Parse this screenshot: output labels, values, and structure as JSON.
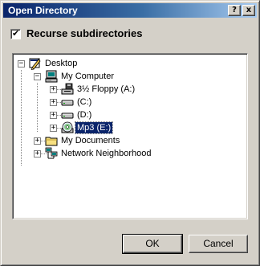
{
  "window": {
    "title": "Open Directory",
    "help_label": "?",
    "close_label": "x"
  },
  "options": {
    "recurse_label": "Recurse subdirectories",
    "recurse_checked": true,
    "check_glyph": "✔"
  },
  "tree": {
    "expanded_glyph": "−",
    "collapsed_glyph": "+",
    "items": [
      {
        "label": "Desktop",
        "icon": "desktop-icon",
        "expanded": true
      },
      {
        "label": "My Computer",
        "icon": "computer-icon",
        "expanded": true
      },
      {
        "label": "3½ Floppy (A:)",
        "icon": "floppy-drive-icon",
        "expanded": false
      },
      {
        "label": "(C:)",
        "icon": "hard-drive-icon",
        "expanded": false
      },
      {
        "label": "(D:)",
        "icon": "hard-drive-icon",
        "expanded": false
      },
      {
        "label": "Mp3 (E:)",
        "icon": "cd-drive-icon",
        "expanded": false,
        "selected": true
      },
      {
        "label": "My Documents",
        "icon": "folder-icon",
        "expanded": false
      },
      {
        "label": "Network Neighborhood",
        "icon": "network-icon",
        "expanded": false
      }
    ]
  },
  "buttons": {
    "ok_label": "OK",
    "cancel_label": "Cancel"
  },
  "colors": {
    "face": "#d4d0c8",
    "title_start": "#0a246a",
    "title_end": "#a6caf0",
    "selection": "#0a246a"
  }
}
